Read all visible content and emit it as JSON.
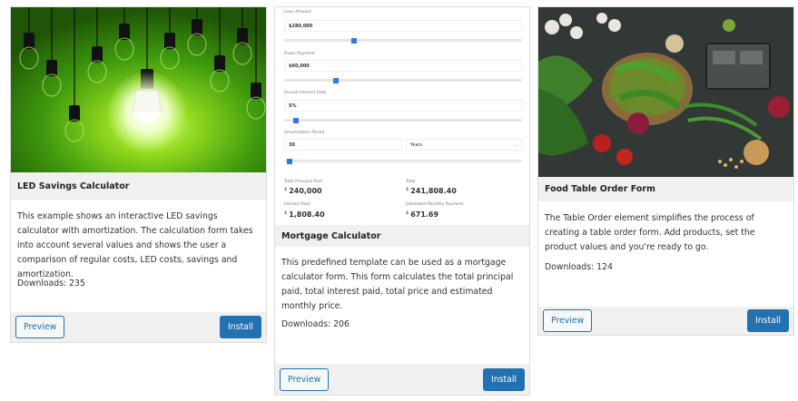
{
  "cards": [
    {
      "title": "LED Savings Calculator",
      "description": "This example shows an interactive LED savings calculator with amortization. The calculation form takes into account several values and shows the user a comparison of regular costs, LED costs, savings and amortization.",
      "downloads": "Downloads: 235",
      "preview_label": "Preview",
      "install_label": "Install"
    },
    {
      "title": "Mortgage Calculator",
      "description": "This predefined template can be used as a mortgage calculator form. This form calculates the total principal paid, total interest paid, total price and estimated monthly price.",
      "downloads": "Downloads: 206",
      "preview_label": "Preview",
      "install_label": "Install",
      "form": {
        "loan_amount_label": "Loan Amount",
        "loan_amount_value": "$280,000",
        "down_payment_label": "Down Payment",
        "down_payment_value": "$60,000",
        "interest_rate_label": "Annual Interest Rate",
        "interest_rate_value": "5%",
        "amortization_label": "Amortization Period",
        "amortization_value": "30",
        "amortization_unit": "Years",
        "sliders": {
          "loan": 0.29,
          "down": 0.21,
          "rate": 0.04,
          "period": 0.01
        },
        "total_principal_label": "Total Principal Paid",
        "total_principal_value": "240,000",
        "total_label": "Total",
        "total_value": "241,808.40",
        "interest_paid_label": "Interest Paid",
        "interest_paid_value": "1,808.40",
        "monthly_label": "Estimated Monthly Payment",
        "monthly_value": "671.69",
        "currency": "$"
      }
    },
    {
      "title": "Food Table Order Form",
      "description": "The Table Order element simplifies the process of creating a table order form. Add products, set the product values and you're ready to go.",
      "downloads": "Downloads: 124",
      "preview_label": "Preview",
      "install_label": "Install"
    }
  ],
  "colors": {
    "accent": "#2271b1",
    "bar": "#f0f0f1",
    "slider": "#2d7de0"
  }
}
